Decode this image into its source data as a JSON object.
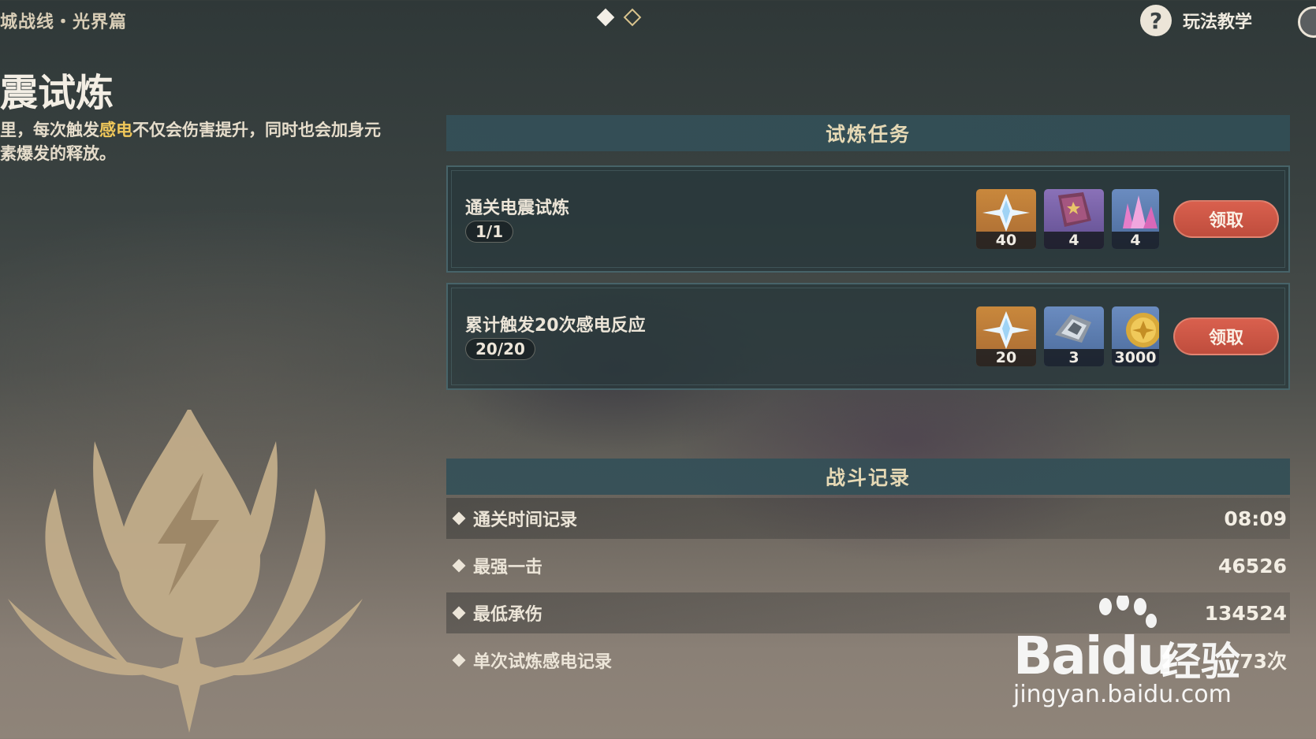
{
  "header": {
    "event_title": "城战线・光界篇",
    "help_label": "玩法教学",
    "help_icon": "question-icon",
    "close_icon": "close-icon"
  },
  "pager": {
    "count": 2,
    "active_index": 0
  },
  "trial": {
    "name": "震试炼",
    "desc_before": "里，每次触发",
    "desc_highlight": "感电",
    "desc_after": "不仅会伤害提升，同时也会加身元素爆发的释放。",
    "highlight_color": "#f0c75a",
    "emblem_icon": "electro-drop-emblem-icon"
  },
  "tasks_section": {
    "title": "试炼任务",
    "claim_label": "领取",
    "tasks": [
      {
        "title": "通关电震试炼",
        "progress": "1/1",
        "rewards": [
          {
            "icon": "primogem-icon",
            "qty": "40",
            "rarity": "gold"
          },
          {
            "icon": "heros-wit-book-icon",
            "qty": "4",
            "rarity": "purple"
          },
          {
            "icon": "crystal-ore-icon",
            "qty": "4",
            "rarity": "blue"
          }
        ]
      },
      {
        "title": "累计触发20次感电反应",
        "progress": "20/20",
        "rewards": [
          {
            "icon": "primogem-icon",
            "qty": "20",
            "rarity": "gold"
          },
          {
            "icon": "mystic-enhancement-ore-icon",
            "qty": "3",
            "rarity": "blue"
          },
          {
            "icon": "mora-coin-icon",
            "qty": "3000",
            "rarity": "blue"
          }
        ]
      }
    ]
  },
  "records_section": {
    "title": "战斗记录",
    "rows": [
      {
        "label": "通关时间记录",
        "value": "08:09"
      },
      {
        "label": "最强一击",
        "value": "46526"
      },
      {
        "label": "最低承伤",
        "value": "134524"
      },
      {
        "label": "单次试炼感电记录",
        "value": "73次"
      }
    ]
  },
  "watermark": {
    "brand_latin": "Bai",
    "brand_du": "du",
    "brand_cn": "经验",
    "url": "jingyan.baidu.com"
  }
}
